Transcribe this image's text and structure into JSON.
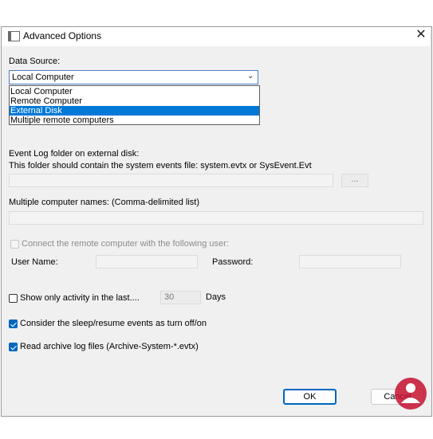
{
  "window": {
    "title": "Advanced Options",
    "close_glyph": "✕"
  },
  "data_source": {
    "label": "Data Source:",
    "selected": "Local Computer",
    "options": [
      "Local Computer",
      "Remote Computer",
      "External Disk",
      "Multiple remote computers"
    ],
    "highlighted_index": 2
  },
  "event_log": {
    "label": "Event Log folder on external disk:",
    "hint": "This folder should contain the system events file: system.evtx or SysEvent.Evt",
    "browse_label": "..."
  },
  "multiple_computers": {
    "label": "Multiple computer names: (Comma-delimited list)"
  },
  "remote_user": {
    "checkbox_label": "Connect the remote computer with the following user:",
    "user_label": "User Name:",
    "password_label": "Password:"
  },
  "activity": {
    "checkbox_label": "Show only activity in the last....",
    "days_value": "30",
    "days_label": "Days"
  },
  "sleep_resume": {
    "checkbox_label": "Consider the sleep/resume events as turn off/on",
    "checked": true
  },
  "archive": {
    "checkbox_label": "Read archive log files (Archive-System-*.evtx)",
    "checked": true
  },
  "buttons": {
    "ok": "OK",
    "cancel": "Cancel"
  },
  "colors": {
    "accent": "#0067c0",
    "selection": "#0078d7",
    "dialog_bg": "#f0f0f0"
  }
}
